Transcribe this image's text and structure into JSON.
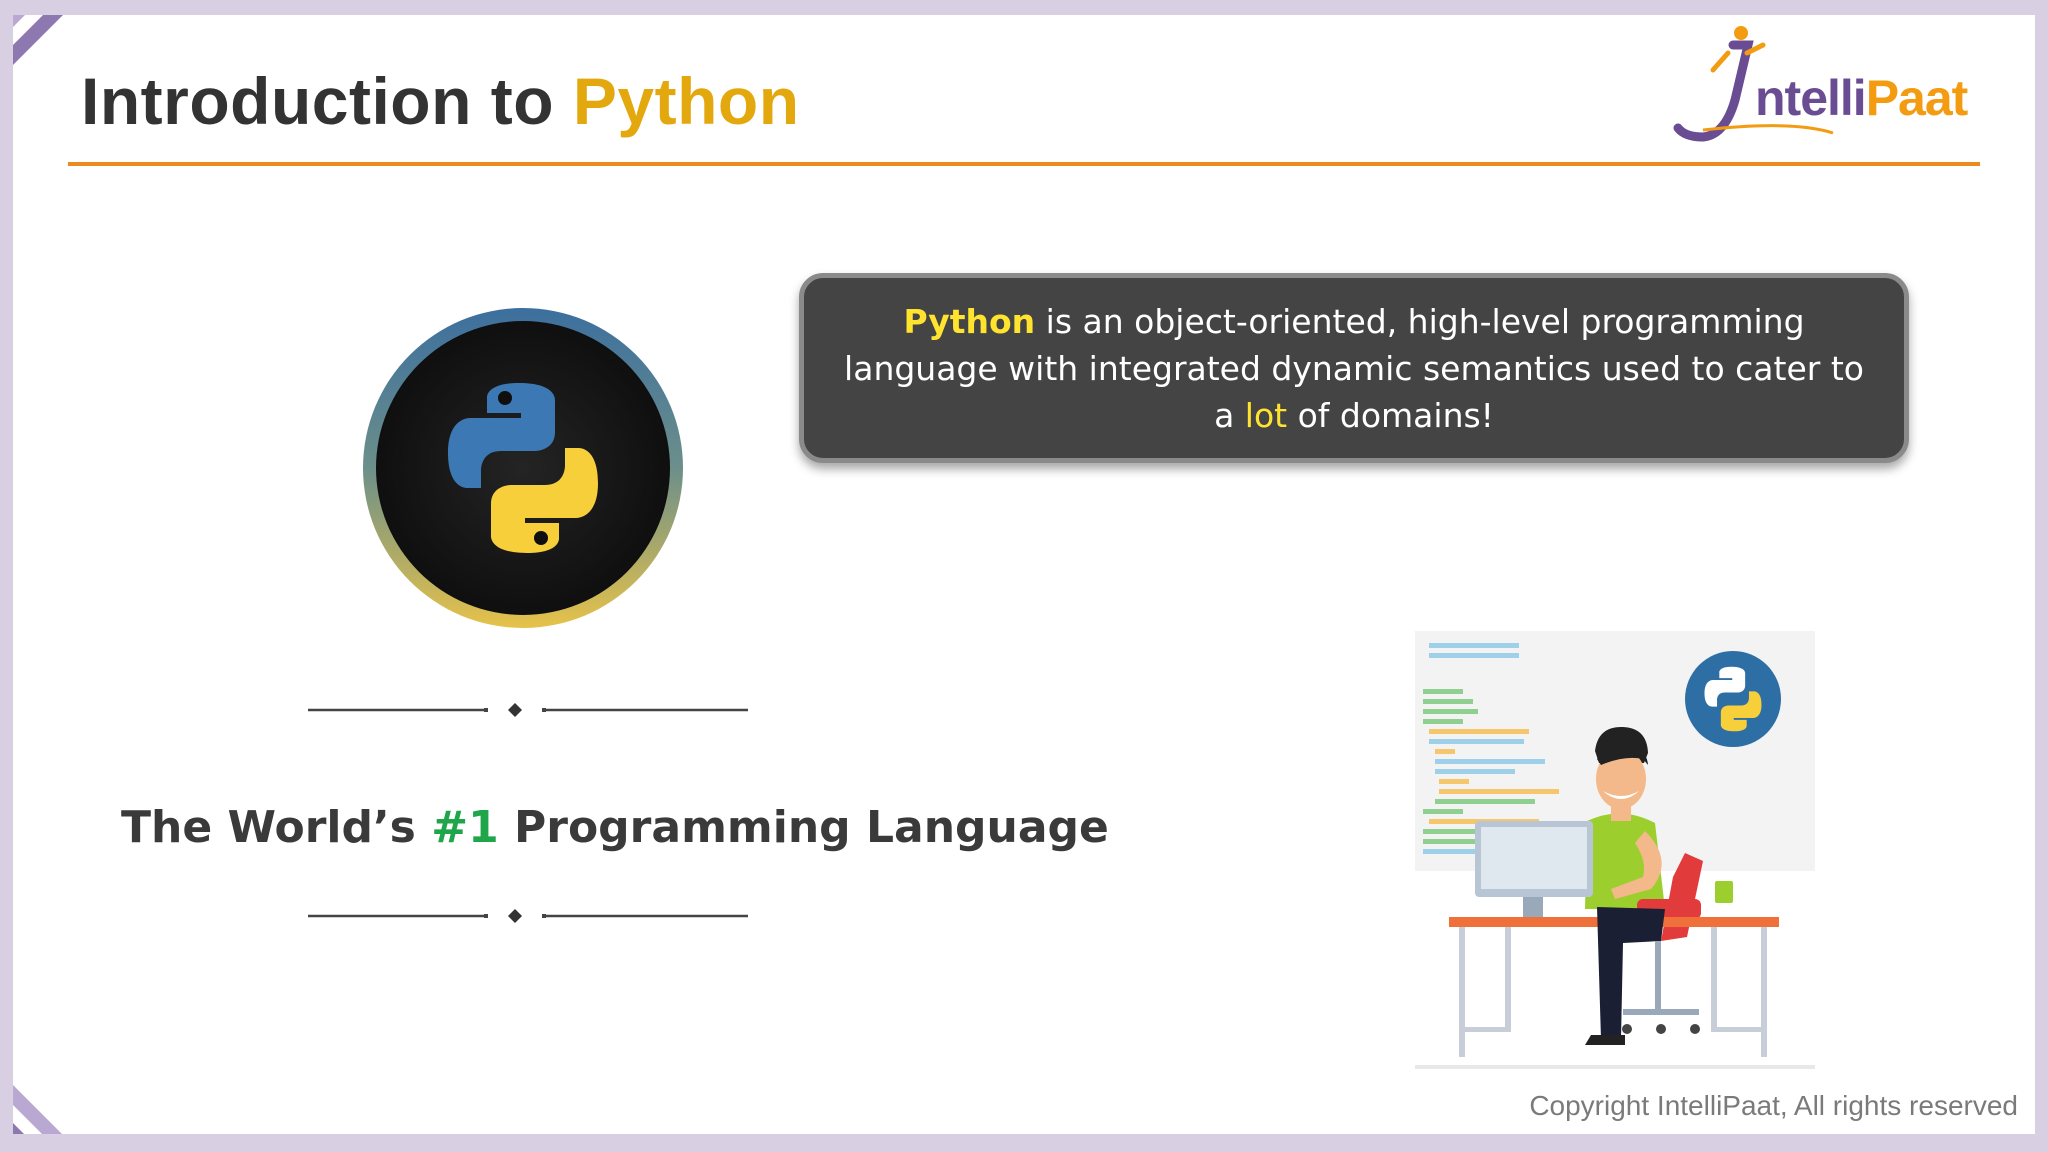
{
  "slide": {
    "title_prefix": "Introduction to ",
    "title_accent": "Python",
    "logo": {
      "wordmark_i": "I",
      "wordmark_main": "ntelli",
      "wordmark_accent": "Paat"
    },
    "callout": {
      "part1": "Python",
      "part2": " is an object-oriented, high-level programming language with integrated dynamic semantics used to cater to a ",
      "part3": "lot",
      "part4": " of domains!"
    },
    "tagline": {
      "part1": "The World’s ",
      "part2": "#1",
      "part3": " Programming Language"
    },
    "copyright": "Copyright IntelliPaat, All rights reserved"
  },
  "colors": {
    "title_accent": "#e4a80f",
    "rule": "#ea8a1f",
    "callout_bg": "#444444",
    "callout_highlight": "#ffe32e",
    "tagline_highlight": "#1fa64a",
    "frame": "#d9cfe3",
    "python_blue": "#3c78b4",
    "python_yellow": "#f7cf3a"
  },
  "icons": [
    "python-logo-icon",
    "python-badge-icon",
    "programmer-illustration",
    "intellipaat-logo",
    "divider-diamond-icon"
  ]
}
